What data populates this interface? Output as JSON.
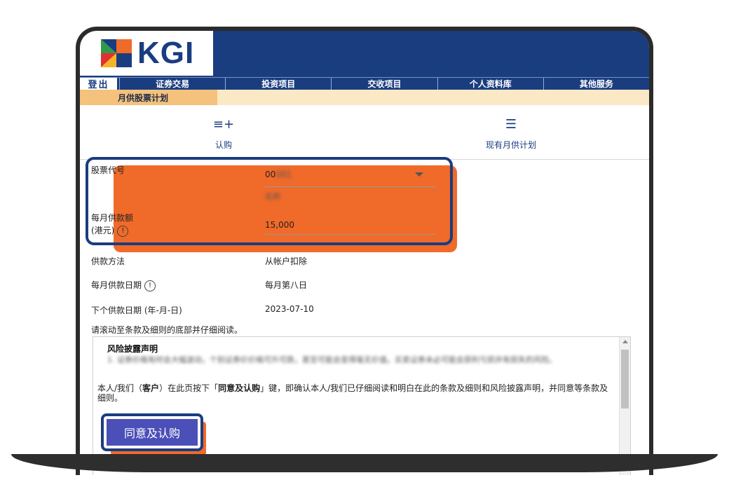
{
  "brand": {
    "name": "KGI",
    "colors": {
      "navy": "#1a3d80",
      "orange": "#f06a2a",
      "button": "#4b4fb8"
    }
  },
  "nav": {
    "logout": "登出",
    "items": [
      "证券交易",
      "投资项目",
      "交收项目",
      "个人资料库",
      "其他服务"
    ],
    "sub_active": "月供股票计划"
  },
  "tabs": {
    "subscribe": {
      "icon": "playlist-add-icon",
      "label": "认购"
    },
    "plans": {
      "icon": "list-icon",
      "label": "现有月供计划"
    }
  },
  "form": {
    "stock_code": {
      "label": "股票代号",
      "value": "00",
      "value_blurred": "001",
      "name_blurred": "名称"
    },
    "monthly_amount": {
      "label_line1": "每月供款额",
      "label_line2": "(港元)",
      "value": "15,000"
    },
    "payment_method": {
      "label": "供款方法",
      "value": "从帐户扣除"
    },
    "monthly_date": {
      "label": "每月供款日期",
      "value": "每月第八日"
    },
    "next_date": {
      "label": "下个供款日期 (年-月-日)",
      "value": "2023-07-10"
    }
  },
  "terms": {
    "instruction": "请滚动至条款及细则的底部并仔细阅读。",
    "title": "风险披露声明",
    "blurred": "1. 证券价格有时会大幅波动，个别证券价价格可升可跌，甚至可能会变得毫无价值。买卖证券未必可能会获利亏损并有损失的风险。",
    "text_before": "本人/我们（",
    "text_customer": "客户",
    "text_middle": "）在此页按下「",
    "text_button": "同意及认购",
    "text_after": "」键，即确认本人/我们已仔细阅读和明白在此的条款及细则和风险披露声明，并同意等条款及细则。"
  },
  "button": {
    "label": "同意及认购"
  }
}
